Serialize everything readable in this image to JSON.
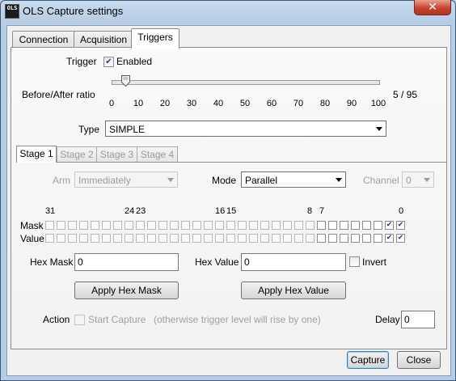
{
  "window": {
    "title": "OLS Capture settings",
    "icon_text": "OLS",
    "close_glyph": "✕"
  },
  "tabs": [
    {
      "label": "Connection",
      "selected": false
    },
    {
      "label": "Acquisition",
      "selected": false
    },
    {
      "label": "Triggers",
      "selected": true
    }
  ],
  "trigger": {
    "label": "Trigger",
    "enabled_label": "Enabled",
    "enabled": true,
    "ratio_label": "Before/After ratio",
    "ratio_value": "5 / 95",
    "ratio_position": 5,
    "ratio_ticks": [
      "0",
      "10",
      "20",
      "30",
      "40",
      "50",
      "60",
      "70",
      "80",
      "90",
      "100"
    ],
    "type_label": "Type",
    "type_value": "SIMPLE"
  },
  "stage_tabs": [
    {
      "label": "Stage 1",
      "selected": true
    },
    {
      "label": "Stage 2",
      "selected": false
    },
    {
      "label": "Stage 3",
      "selected": false
    },
    {
      "label": "Stage 4",
      "selected": false
    }
  ],
  "stage": {
    "arm_label": "Arm",
    "arm_value": "Immediately",
    "mode_label": "Mode",
    "mode_value": "Parallel",
    "channel_label": "Channel",
    "channel_value": "0",
    "bit_labels": [
      "31",
      "24",
      "23",
      "16",
      "15",
      "8",
      "7",
      "0"
    ],
    "mask_label": "Mask",
    "value_label": "Value",
    "mask_checked_bits": [
      0,
      1
    ],
    "value_checked_bits": [
      0,
      1
    ],
    "hex_mask_label": "Hex Mask",
    "hex_mask_value": "0",
    "hex_value_label": "Hex Value",
    "hex_value_value": "0",
    "invert_label": "Invert",
    "apply_hex_mask_label": "Apply Hex Mask",
    "apply_hex_value_label": "Apply Hex Value",
    "action_label": "Action",
    "start_capture_label": "Start Capture",
    "action_note": "(otherwise trigger level will rise by one)",
    "delay_label": "Delay",
    "delay_value": "0"
  },
  "footer": {
    "capture_label": "Capture",
    "close_label": "Close"
  },
  "colors": {
    "title_bar": "#b5cde6",
    "close_button": "#c7432b",
    "check_mark": "#223c8a"
  }
}
